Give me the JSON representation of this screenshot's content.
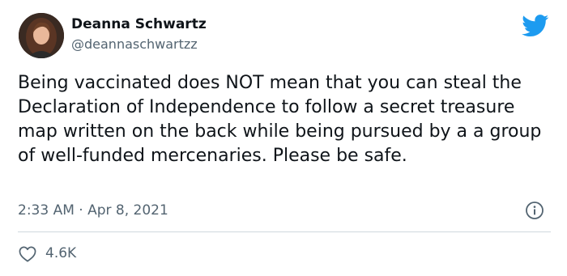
{
  "author": {
    "display_name": "Deanna Schwartz",
    "handle": "@deannaschwartzz"
  },
  "tweet": {
    "text": "Being vaccinated does NOT mean that you can steal the Declaration of Independence to follow a secret treasure map written on the back while being pursued by a a group of well-funded mercenaries. Please be safe.",
    "timestamp": "2:33 AM · Apr 8, 2021",
    "likes": "4.6K"
  },
  "icons": {
    "brand": "twitter-bird-icon",
    "info": "info-icon",
    "like": "heart-icon"
  },
  "colors": {
    "brand_blue": "#1d9bf0",
    "secondary_text": "#536471",
    "primary_text": "#0f1419",
    "divider": "#cfd9de"
  }
}
